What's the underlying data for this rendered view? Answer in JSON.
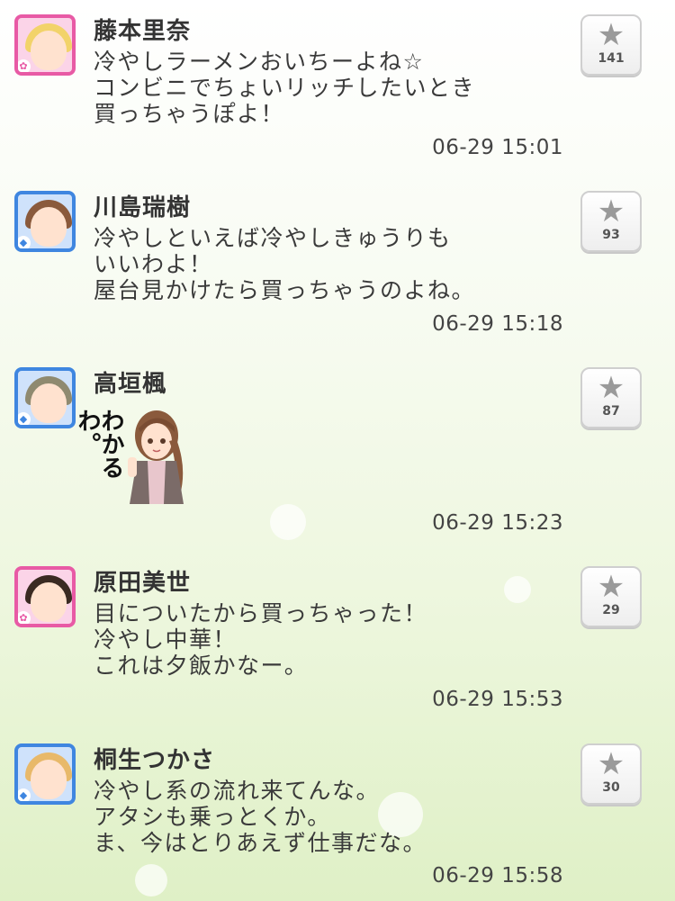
{
  "posts": [
    {
      "name": "藤本里奈",
      "lines": [
        "冷やしラーメンおいちーよね☆",
        "コンビニでちょいリッチしたいとき",
        "買っちゃうぽよ！"
      ],
      "time": "06-29 15:01",
      "likes": "141",
      "avatar_type": "cute",
      "hair_color": "#f2d36a"
    },
    {
      "name": "川島瑞樹",
      "lines": [
        "冷やしといえば冷やしきゅうりも",
        "いいわよ！",
        "屋台見かけたら買っちゃうのよね。"
      ],
      "time": "06-29 15:18",
      "likes": "93",
      "avatar_type": "cool",
      "hair_color": "#8a5a3c"
    },
    {
      "name": "高垣楓",
      "stamp_text": "わかるわ。",
      "time": "06-29 15:23",
      "likes": "87",
      "avatar_type": "cool",
      "hair_color": "#8f8a70"
    },
    {
      "name": "原田美世",
      "lines": [
        "目についたから買っちゃった！",
        "冷やし中華！",
        "これは夕飯かなー。"
      ],
      "time": "06-29 15:53",
      "likes": "29",
      "avatar_type": "cute",
      "hair_color": "#3a2a22"
    },
    {
      "name": "桐生つかさ",
      "lines": [
        "冷やし系の流れ来てんな。",
        "アタシも乗っとくか。",
        "ま、今はとりあえず仕事だな。"
      ],
      "time": "06-29 15:58",
      "likes": "30",
      "avatar_type": "cool",
      "hair_color": "#e8b96a"
    }
  ],
  "icons": {
    "like": "star-icon",
    "cute_badge": "flower-icon",
    "cool_badge": "diamond-icon"
  },
  "colors": {
    "cute": "#e85aa5",
    "cool": "#3f86e0",
    "star": "#9a9a9a"
  }
}
